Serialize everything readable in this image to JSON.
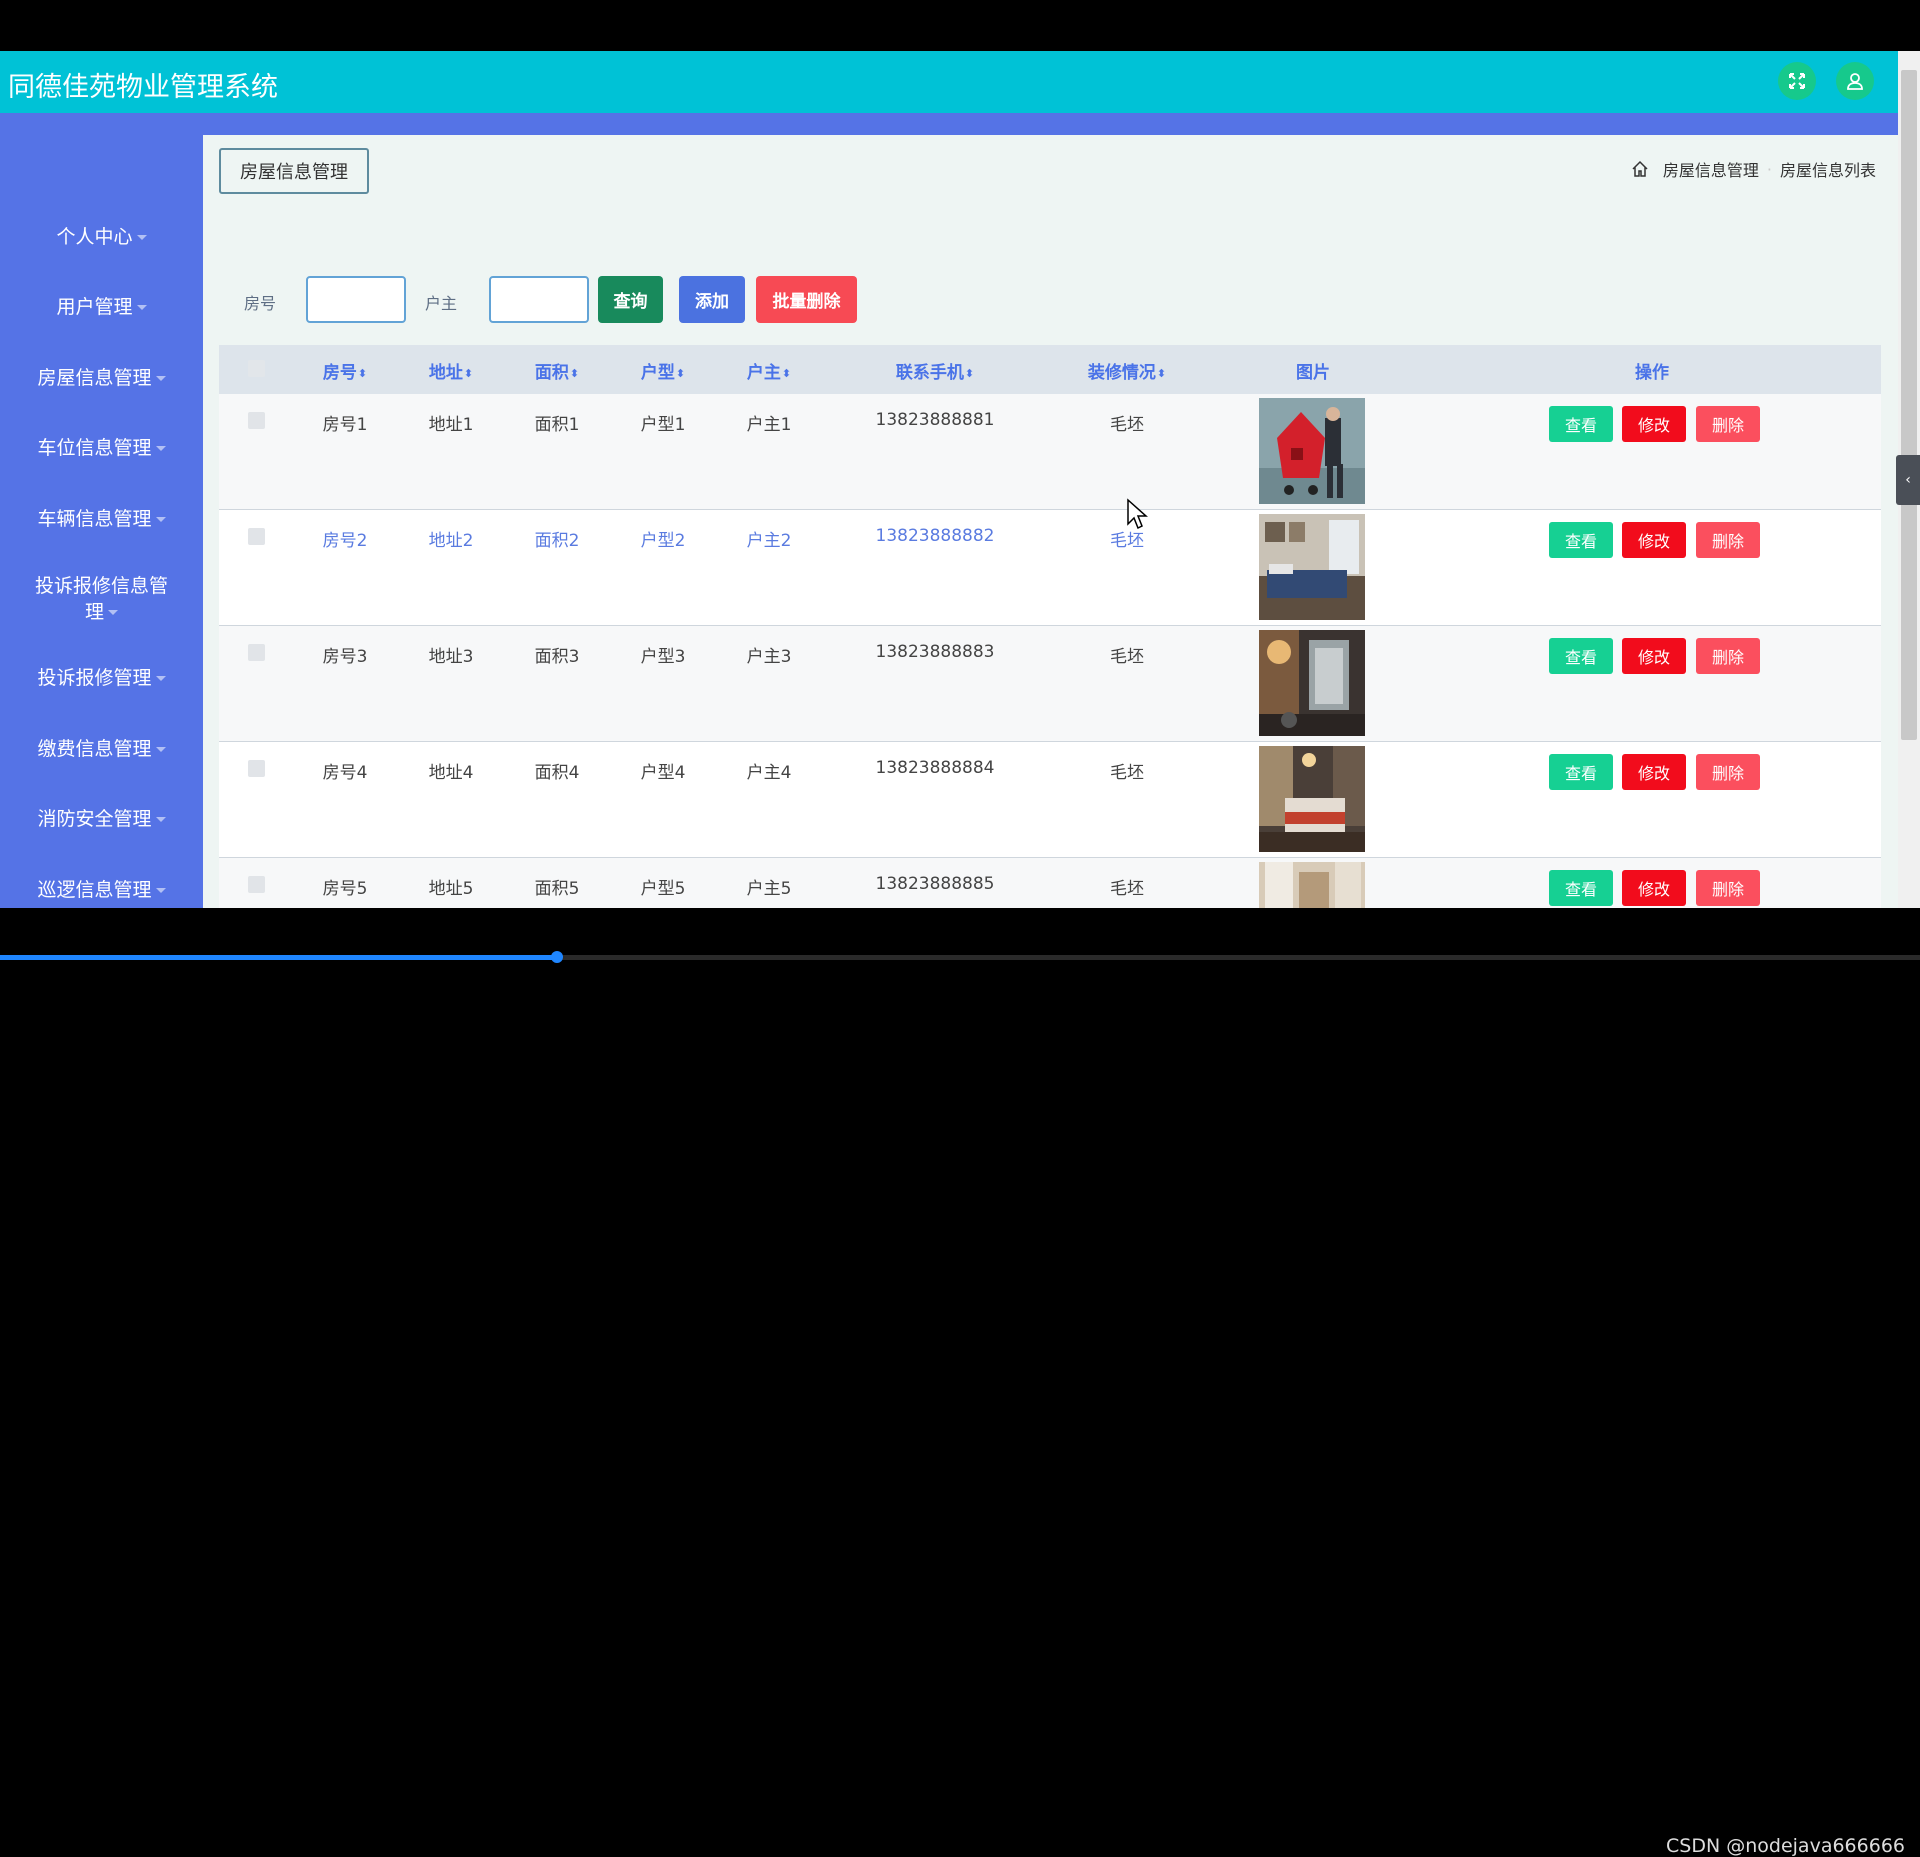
{
  "app": {
    "title": "同德佳苑物业管理系统",
    "colors": {
      "topbar": "#00c2d6",
      "sidebar": "#5573e6",
      "view_btn": "#16d093",
      "edit_btn": "#f20c1c",
      "delete_btn": "#fb4f5e"
    }
  },
  "topbar": {
    "icons": [
      "fullscreen-icon",
      "user-icon"
    ]
  },
  "sidebar": {
    "items": [
      {
        "label": "个人中心"
      },
      {
        "label": "用户管理"
      },
      {
        "label": "房屋信息管理"
      },
      {
        "label": "车位信息管理"
      },
      {
        "label": "车辆信息管理"
      },
      {
        "label": "投诉报修信息管",
        "label2": "理"
      },
      {
        "label": "投诉报修管理"
      },
      {
        "label": "缴费信息管理"
      },
      {
        "label": "消防安全管理"
      },
      {
        "label": "巡逻信息管理"
      }
    ]
  },
  "page": {
    "title": "房屋信息管理",
    "breadcrumb": [
      "房屋信息管理",
      "房屋信息列表"
    ]
  },
  "search": {
    "room_label": "房号",
    "room_value": "",
    "owner_label": "户主",
    "owner_value": "",
    "query_label": "查询",
    "add_label": "添加",
    "batch_delete_label": "批量删除"
  },
  "table": {
    "headers": {
      "room": "房号",
      "address": "地址",
      "area": "面积",
      "layout": "户型",
      "owner": "户主",
      "phone": "联系手机",
      "decoration": "装修情况",
      "image": "图片",
      "actions": "操作"
    },
    "sort_icon": "⬍",
    "action_labels": {
      "view": "查看",
      "edit": "修改",
      "delete": "删除"
    },
    "rows": [
      {
        "room": "房号1",
        "address": "地址1",
        "area": "面积1",
        "layout": "户型1",
        "owner": "户主1",
        "phone": "13823888881",
        "decoration": "毛坯"
      },
      {
        "room": "房号2",
        "address": "地址2",
        "area": "面积2",
        "layout": "户型2",
        "owner": "户主2",
        "phone": "13823888882",
        "decoration": "毛坯"
      },
      {
        "room": "房号3",
        "address": "地址3",
        "area": "面积3",
        "layout": "户型3",
        "owner": "户主3",
        "phone": "13823888883",
        "decoration": "毛坯"
      },
      {
        "room": "房号4",
        "address": "地址4",
        "area": "面积4",
        "layout": "户型4",
        "owner": "户主4",
        "phone": "13823888884",
        "decoration": "毛坯"
      },
      {
        "room": "房号5",
        "address": "地址5",
        "area": "面积5",
        "layout": "户型5",
        "owner": "户主5",
        "phone": "13823888885",
        "decoration": "毛坯"
      }
    ]
  },
  "video": {
    "watermark": "CSDN @nodejava666666",
    "progress": 0.29
  }
}
